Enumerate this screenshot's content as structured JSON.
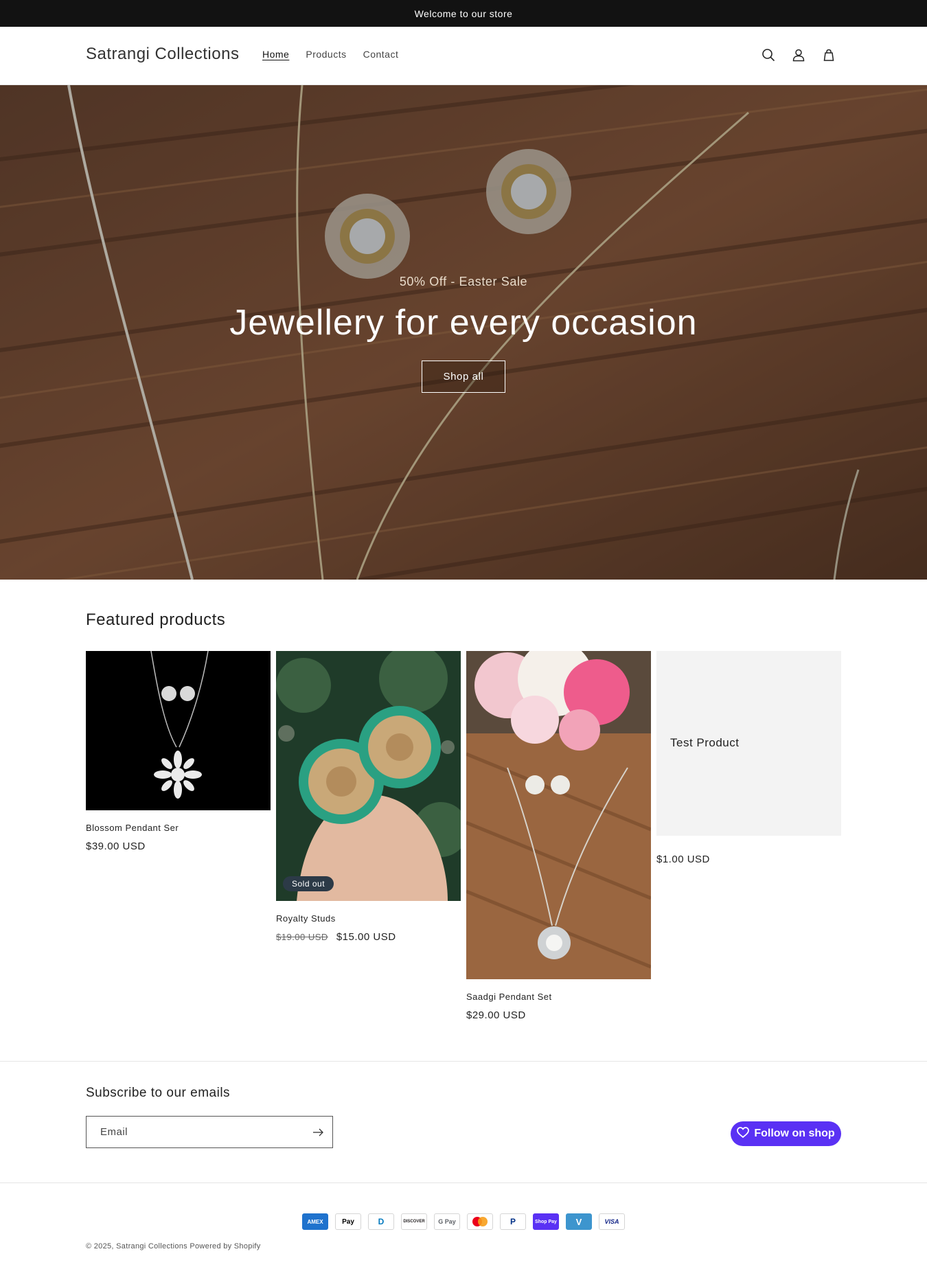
{
  "announcement": {
    "text": "Welcome to our store"
  },
  "header": {
    "logo": "Satrangi Collections",
    "nav": [
      {
        "label": "Home"
      },
      {
        "label": "Products"
      },
      {
        "label": "Contact"
      }
    ]
  },
  "hero": {
    "subtitle": "50% Off - Easter Sale",
    "title": "Jewellery for every occasion",
    "button": "Shop all"
  },
  "featured": {
    "title": "Featured products",
    "products": [
      {
        "title": "Blossom Pendant Ser",
        "price": "$39.00 USD"
      },
      {
        "title": "Royalty Studs",
        "old_price": "$19.00 USD",
        "price": "$15.00 USD",
        "badge": "Sold out"
      },
      {
        "title": "Saadgi Pendant Set",
        "price": "$29.00 USD"
      },
      {
        "title": "Test Product",
        "price": "$1.00 USD"
      }
    ]
  },
  "newsletter": {
    "title": "Subscribe to our emails",
    "placeholder": "Email",
    "follow_label": "Follow on shop"
  },
  "footer": {
    "payments": [
      "AMEX",
      "Pay",
      "D",
      "DISCOVER",
      "G Pay",
      "MC",
      "P",
      "Shop Pay",
      "V",
      "VISA"
    ],
    "copyright_prefix": "© 2025, ",
    "copyright_link": "Satrangi Collections",
    "powered": " Powered by Shopify"
  },
  "colors": {
    "announcement_bg": "#121212",
    "shop_purple": "#5a31f4",
    "badge_bg": "#2c3a47"
  }
}
